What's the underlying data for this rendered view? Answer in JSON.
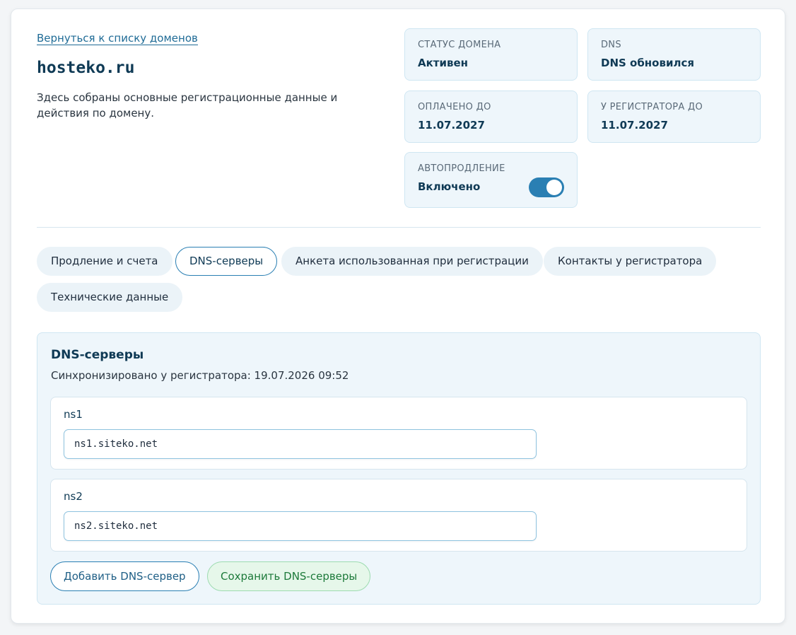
{
  "header": {
    "back_link": "Вернуться к списку доменов",
    "domain": "hosteko.ru",
    "description": "Здесь собраны основные регистрационные данные и действия по домену."
  },
  "info": {
    "status": {
      "label": "Статус домена",
      "value": "Активен"
    },
    "dns": {
      "label": "DNS",
      "value": "DNS обновился"
    },
    "paid_until": {
      "label": "Оплачено до",
      "value": "11.07.2027"
    },
    "registrar_until": {
      "label": "У регистратора до",
      "value": "11.07.2027"
    },
    "autorenew": {
      "label": "Автопродление",
      "value": "Включено",
      "enabled": true
    }
  },
  "tabs": [
    {
      "label": "Продление и счета",
      "active": false
    },
    {
      "label": "DNS-серверы",
      "active": true
    },
    {
      "label": "Анкета использованная при регистрации",
      "active": false
    },
    {
      "label": "Контакты у регистратора",
      "active": false
    },
    {
      "label": "Технические данные",
      "active": false
    }
  ],
  "dns_panel": {
    "title": "DNS-серверы",
    "sync_text": "Синхронизировано у регистратора: 19.07.2026 09:52",
    "servers": [
      {
        "label": "ns1",
        "value": "ns1.siteko.net"
      },
      {
        "label": "ns2",
        "value": "ns2.siteko.net"
      }
    ],
    "add_button": "Добавить DNS-сервер",
    "save_button": "Сохранить DNS-серверы"
  },
  "colors": {
    "accent": "#2a7fb3",
    "info_bg": "#eef6fb",
    "save_green": "#1d7a3a"
  }
}
